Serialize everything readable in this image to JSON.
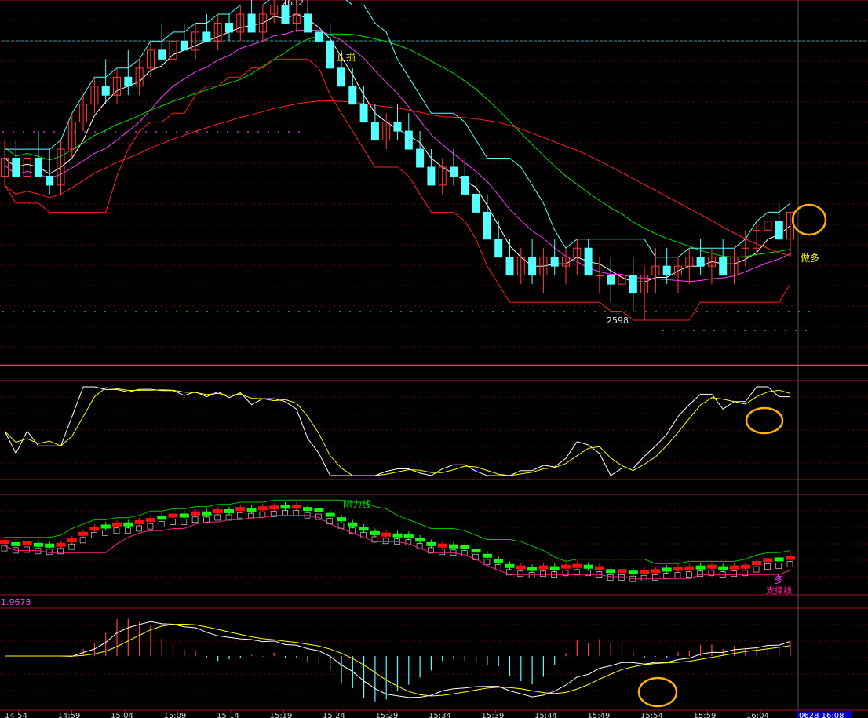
{
  "chart_data": {
    "type": "candlestick",
    "time_axis_labels": [
      "14:54",
      "14:59",
      "15:04",
      "15:09",
      "15:14",
      "15:19",
      "15:24",
      "15:29",
      "15:34",
      "15:39",
      "15:44",
      "15:49",
      "15:54",
      "15:59",
      "16:04"
    ],
    "current_time_label": "0628 16:08",
    "main_panel": {
      "high_label": "2632",
      "low_label": "2598",
      "annotations": {
        "stop_loss": "止损",
        "go_long": "做多"
      },
      "candles": [
        [
          2614,
          2618,
          2613,
          2616
        ],
        [
          2616,
          2618,
          2614,
          2614
        ],
        [
          2614,
          2618,
          2613,
          2616
        ],
        [
          2616,
          2619,
          2614,
          2614
        ],
        [
          2614,
          2617,
          2612,
          2613
        ],
        [
          2613,
          2618,
          2612,
          2617
        ],
        [
          2617,
          2621,
          2616,
          2620
        ],
        [
          2620,
          2623,
          2619,
          2622
        ],
        [
          2622,
          2625,
          2621,
          2624
        ],
        [
          2624,
          2627,
          2622,
          2623
        ],
        [
          2623,
          2626,
          2622,
          2625
        ],
        [
          2625,
          2628,
          2623,
          2624
        ],
        [
          2624,
          2627,
          2623,
          2626
        ],
        [
          2626,
          2629,
          2625,
          2628
        ],
        [
          2628,
          2631,
          2627,
          2627
        ],
        [
          2627,
          2629,
          2626,
          2629
        ],
        [
          2629,
          2631,
          2628,
          2628
        ],
        [
          2628,
          2631,
          2627,
          2630
        ],
        [
          2630,
          2632,
          2629,
          2629
        ],
        [
          2629,
          2632,
          2628,
          2631
        ],
        [
          2631,
          2632,
          2629,
          2630
        ],
        [
          2630,
          2633,
          2629,
          2632
        ],
        [
          2632,
          2634,
          2631,
          2630
        ],
        [
          2630,
          2633,
          2629,
          2632
        ],
        [
          2632,
          2634,
          2631,
          2633
        ],
        [
          2633,
          2635,
          2632,
          2631
        ],
        [
          2631,
          2634,
          2630,
          2632
        ],
        [
          2632,
          2635,
          2630,
          2630
        ],
        [
          2630,
          2632,
          2628,
          2629
        ],
        [
          2629,
          2631,
          2626,
          2626
        ],
        [
          2626,
          2628,
          2624,
          2624
        ],
        [
          2624,
          2626,
          2622,
          2622
        ],
        [
          2622,
          2624,
          2620,
          2620
        ],
        [
          2620,
          2622,
          2618,
          2618
        ],
        [
          2618,
          2621,
          2617,
          2620
        ],
        [
          2620,
          2622,
          2618,
          2619
        ],
        [
          2619,
          2621,
          2617,
          2617
        ],
        [
          2617,
          2619,
          2615,
          2615
        ],
        [
          2615,
          2617,
          2613,
          2613
        ],
        [
          2613,
          2616,
          2612,
          2615
        ],
        [
          2615,
          2617,
          2613,
          2614
        ],
        [
          2614,
          2616,
          2612,
          2612
        ],
        [
          2612,
          2614,
          2610,
          2610
        ],
        [
          2610,
          2612,
          2607,
          2607
        ],
        [
          2607,
          2609,
          2605,
          2605
        ],
        [
          2605,
          2607,
          2603,
          2603
        ],
        [
          2603,
          2606,
          2602,
          2605
        ],
        [
          2605,
          2607,
          2602,
          2603
        ],
        [
          2603,
          2606,
          2601,
          2605
        ],
        [
          2605,
          2607,
          2603,
          2604
        ],
        [
          2604,
          2606,
          2602,
          2605
        ],
        [
          2605,
          2607,
          2603,
          2606
        ],
        [
          2606,
          2607,
          2603,
          2603
        ],
        [
          2603,
          2605,
          2601,
          2603
        ],
        [
          2603,
          2605,
          2600,
          2602
        ],
        [
          2602,
          2604,
          2600,
          2603
        ],
        [
          2603,
          2605,
          2599,
          2601
        ],
        [
          2601,
          2604,
          2598,
          2603
        ],
        [
          2603,
          2606,
          2601,
          2604
        ],
        [
          2604,
          2606,
          2602,
          2603
        ],
        [
          2603,
          2605,
          2601,
          2604
        ],
        [
          2604,
          2606,
          2602,
          2605
        ],
        [
          2605,
          2607,
          2603,
          2604
        ],
        [
          2604,
          2606,
          2602,
          2605
        ],
        [
          2605,
          2607,
          2603,
          2603
        ],
        [
          2603,
          2606,
          2602,
          2605
        ],
        [
          2605,
          2608,
          2604,
          2606
        ],
        [
          2606,
          2609,
          2605,
          2608
        ],
        [
          2608,
          2610,
          2606,
          2609
        ],
        [
          2609,
          2611,
          2607,
          2607
        ],
        [
          2607,
          2610,
          2605,
          2610
        ]
      ],
      "colors": {
        "up": "#ff3c3c",
        "down": "#54ffff",
        "ma_white": "#ffffff",
        "ma_magenta": "#ff38ff",
        "ma_green": "#00e000",
        "ma_red": "#ff2020",
        "stop_line": "#ff2020",
        "cyan_line": "#54ffff",
        "label": "#ffff00",
        "circle": "#ffb000"
      }
    },
    "kdj_panel": {
      "k_color": "#ffffff",
      "d_color": "#ffff00"
    },
    "channel_panel": {
      "resistance_label": "阻力线",
      "support_label": "支撑线",
      "long_label": "多",
      "colors": {
        "up_box": "#ff1010",
        "down_box": "#10ff10",
        "resistance": "#00c000",
        "support": "#ff1a8c"
      }
    },
    "macd_panel": {
      "value_label": "1.9678",
      "colors": {
        "dif": "#ffffff",
        "dea": "#ffff00",
        "pos_bar": "#ff4040",
        "neg_bar": "#54ffff"
      }
    }
  }
}
